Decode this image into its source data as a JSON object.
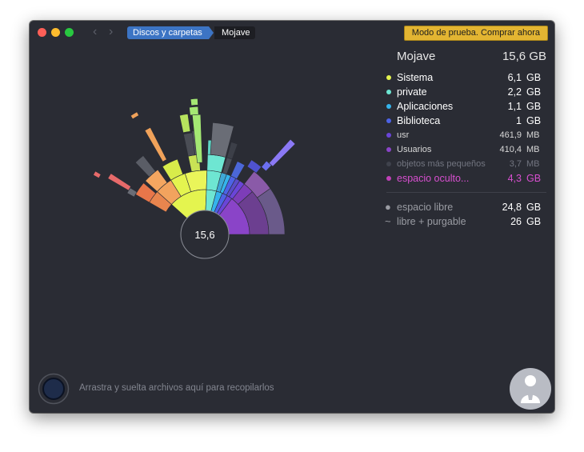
{
  "window": {
    "nav": {
      "back": "‹",
      "forward": "›"
    },
    "breadcrumb": [
      {
        "label": "Discos y carpetas"
      },
      {
        "label": "Mojave"
      }
    ],
    "trial_button": "Modo de prueba. Comprar ahora"
  },
  "center_label": "15,6",
  "summary": {
    "title": "Mojave",
    "total": "15,6 GB"
  },
  "items": [
    {
      "name": "Sistema",
      "value": "6,1",
      "unit": "GB",
      "color": "#e4f44f",
      "text": "#ffffff",
      "small": false
    },
    {
      "name": "private",
      "value": "2,2",
      "unit": "GB",
      "color": "#6ee6d2",
      "text": "#ffffff",
      "small": false
    },
    {
      "name": "Aplicaciones",
      "value": "1,1",
      "unit": "GB",
      "color": "#35b4ec",
      "text": "#ffffff",
      "small": false
    },
    {
      "name": "Biblioteca",
      "value": "1",
      "unit": "GB",
      "color": "#4d63e6",
      "text": "#ffffff",
      "small": false
    },
    {
      "name": "usr",
      "value": "461,9",
      "unit": "MB",
      "color": "#6a45d8",
      "text": "#d8d8d8",
      "small": true
    },
    {
      "name": "Usuarios",
      "value": "410,4",
      "unit": "MB",
      "color": "#8a44c8",
      "text": "#d8d8d8",
      "small": true
    },
    {
      "name": "objetos más pequeños",
      "value": "3,7",
      "unit": "MB",
      "color": "#3f424c",
      "text": "#727580",
      "small": true
    },
    {
      "name": "espacio oculto...",
      "value": "4,3",
      "unit": "GB",
      "color": "#c040b8",
      "text": "#d84fd0",
      "small": false
    }
  ],
  "free_items": [
    {
      "name": "espacio libre",
      "value": "24,8",
      "unit": "GB",
      "marker": "●"
    },
    {
      "name": "libre + purgable",
      "value": "26",
      "unit": "GB",
      "marker": "~"
    }
  ],
  "drop_hint": "Arrastra y suelta archivos aquí para recopilarlos",
  "icons": [
    "close-icon",
    "minimize-icon",
    "zoom-icon",
    "chevron-left-icon",
    "chevron-right-icon",
    "drop-target-icon",
    "logo-icon"
  ]
}
